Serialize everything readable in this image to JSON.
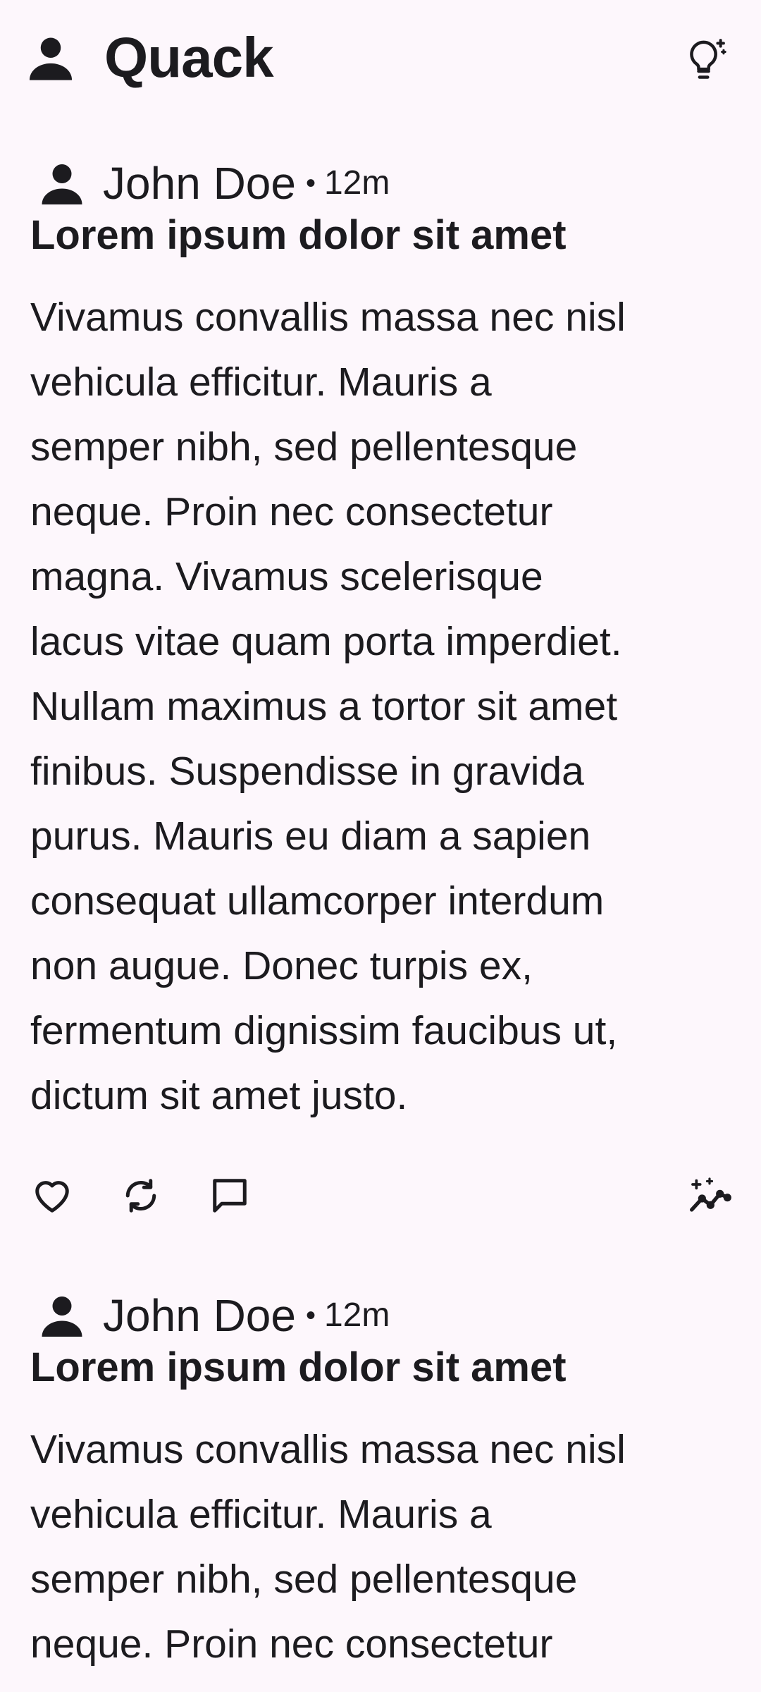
{
  "app": {
    "title": "Quack",
    "icons": {
      "profile": "person-icon",
      "idea": "lightbulb-sparkle-icon"
    }
  },
  "posts": [
    {
      "author": "John Doe",
      "separator": "•",
      "time": "12m",
      "title": "Lorem ipsum dolor sit amet",
      "body": "Vivamus convallis massa nec nisl\nvehicula efficitur. Mauris a\nsemper nibh, sed pellentesque\nneque. Proin nec consectetur\nmagna. Vivamus scelerisque\nlacus vitae quam porta imperdiet.\nNullam maximus a tortor sit amet\nfinibus. Suspendisse in gravida\npurus. Mauris eu diam a sapien\nconsequat ullamcorper interdum\nnon augue. Donec turpis ex,\nfermentum dignissim faucibus ut,\ndictum sit amet justo.",
      "actions": [
        "heart-icon",
        "repost-icon",
        "comment-icon",
        "insights-icon"
      ]
    },
    {
      "author": "John Doe",
      "separator": "•",
      "time": "12m",
      "title": "Lorem ipsum dolor sit amet",
      "body": "Vivamus convallis massa nec nisl\nvehicula efficitur. Mauris a\nsemper nibh, sed pellentesque\nneque. Proin nec consectetur"
    }
  ],
  "colors": {
    "background": "#fdf7fc",
    "text": "#1c1b1f"
  }
}
